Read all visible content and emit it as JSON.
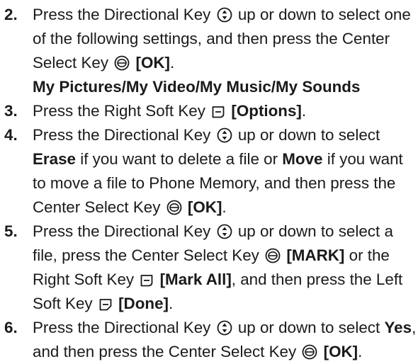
{
  "steps": [
    {
      "number": "2.",
      "segments": [
        {
          "t": "Press the Directional Key "
        },
        {
          "icon": "nav"
        },
        {
          "t": " up or down to select one of the following settings, and then press the Center Select Key "
        },
        {
          "icon": "ok"
        },
        {
          "t": " "
        },
        {
          "b": "[OK]"
        },
        {
          "t": "."
        }
      ],
      "subhead": "My Pictures/My Video/My Music/My Sounds"
    },
    {
      "number": "3.",
      "segments": [
        {
          "t": "Press the Right Soft Key "
        },
        {
          "icon": "rsoft"
        },
        {
          "t": " "
        },
        {
          "b": "[Options]"
        },
        {
          "t": "."
        }
      ]
    },
    {
      "number": "4.",
      "segments": [
        {
          "t": "Press the Directional Key "
        },
        {
          "icon": "nav"
        },
        {
          "t": " up or down to select "
        },
        {
          "b": "Erase"
        },
        {
          "t": " if you want to delete a file or "
        },
        {
          "b": "Move"
        },
        {
          "t": " if you want to move a file to Phone Memory, and then press the Center Select Key "
        },
        {
          "icon": "ok"
        },
        {
          "t": " "
        },
        {
          "b": "[OK]"
        },
        {
          "t": "."
        }
      ]
    },
    {
      "number": "5.",
      "segments": [
        {
          "t": "Press the Directional Key "
        },
        {
          "icon": "nav"
        },
        {
          "t": " up or down to select a file, press the Center Select Key "
        },
        {
          "icon": "ok"
        },
        {
          "t": " "
        },
        {
          "b": "[MARK]"
        },
        {
          "t": " or the Right Soft Key "
        },
        {
          "icon": "rsoft"
        },
        {
          "t": " "
        },
        {
          "b": "[Mark All]"
        },
        {
          "t": ", and then press the Left Soft Key "
        },
        {
          "icon": "lsoft"
        },
        {
          "t": " "
        },
        {
          "b": "[Done]"
        },
        {
          "t": "."
        }
      ]
    },
    {
      "number": "6.",
      "segments": [
        {
          "t": "Press the Directional Key "
        },
        {
          "icon": "nav"
        },
        {
          "t": " up or down to select "
        },
        {
          "b": "Yes"
        },
        {
          "t": ", and then press the Center Select Key "
        },
        {
          "icon": "ok"
        },
        {
          "t": " "
        },
        {
          "b": "[OK]"
        },
        {
          "t": "."
        }
      ]
    }
  ],
  "icons": {
    "nav": "directional-key-icon",
    "ok": "center-select-key-icon",
    "rsoft": "right-soft-key-icon",
    "lsoft": "left-soft-key-icon"
  }
}
